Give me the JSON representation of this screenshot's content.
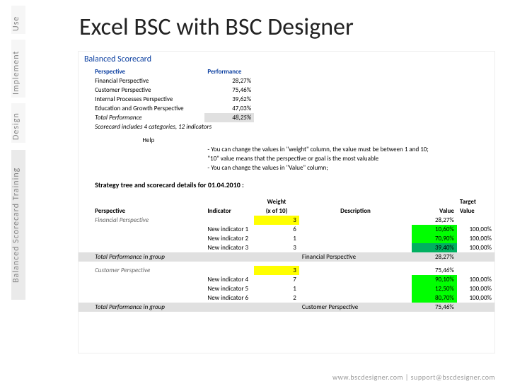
{
  "sidebar": {
    "use": "Use",
    "implement": "Implement",
    "design": "Design",
    "training": "Balanced Scorecard Training"
  },
  "title": "Excel BSC with BSC Designer",
  "sheet": {
    "header": "Balanced Scorecard",
    "columns": {
      "perspective": "Perspective",
      "performance": "Performance"
    },
    "rows": [
      {
        "label": "Financial Perspective",
        "value": "28,27%"
      },
      {
        "label": "Customer Perspective",
        "value": "75,46%"
      },
      {
        "label": "Internal Processes Perspective",
        "value": "39,62%"
      },
      {
        "label": "Education and Growth Perspective",
        "value": "47,03%"
      }
    ],
    "total": {
      "label": "Total Performance",
      "value": "48,25%"
    },
    "note": "Scorecard includes 4 categories, 12 indicators",
    "help": {
      "title": "Help",
      "line1": "- You can change the values in \"weight\" column, the value must be between 1 and 10;",
      "line2": "\"10\" value means that the perspective or goal is the most valuable",
      "line3": "- You can change the values in \"Value\" column;"
    },
    "detail_header": "Strategy tree and scorecard details for 01.04.2010 :",
    "detail_cols": {
      "perspective": "Perspective",
      "indicator": "Indicator",
      "weight": "Weight",
      "weight2": "(x of 10)",
      "description": "Description",
      "value": "Value",
      "target": "Target",
      "target2": "Value"
    },
    "groups": [
      {
        "name": "Financial Perspective",
        "weight": "3",
        "groupval": "28,27%",
        "rows": [
          {
            "ind": "New indicator 1",
            "w": "6",
            "val": "10,60%",
            "tgt": "100,00%"
          },
          {
            "ind": "New indicator 2",
            "w": "1",
            "val": "70,90%",
            "tgt": "100,00%"
          },
          {
            "ind": "New indicator 3",
            "w": "3",
            "val": "39,40%",
            "tgt": "100,00%"
          }
        ],
        "total_label": "Total Performance in group",
        "total_desc": "Financial Perspective",
        "total_val": "28,27%"
      },
      {
        "name": "Customer Perspective",
        "weight": "3",
        "groupval": "75,46%",
        "rows": [
          {
            "ind": "New indicator 4",
            "w": "7",
            "val": "90,10%",
            "tgt": "100,00%"
          },
          {
            "ind": "New indicator 5",
            "w": "1",
            "val": "12,50%",
            "tgt": "100,00%"
          },
          {
            "ind": "New indicator 6",
            "w": "2",
            "val": "80,70%",
            "tgt": "100,00%"
          }
        ],
        "total_label": "Total Performance in group",
        "total_desc": "Customer Perspective",
        "total_val": "75,46%"
      }
    ]
  },
  "footer": "www.bscdesigner.com | support@bscdesigner.com"
}
